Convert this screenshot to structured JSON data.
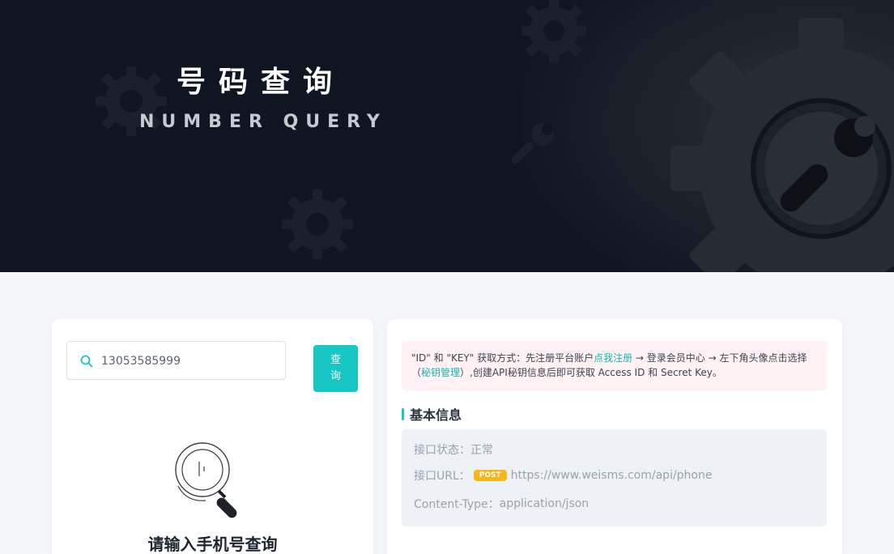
{
  "hero": {
    "title": "号码查询",
    "subtitle": "NUMBER QUERY"
  },
  "search": {
    "value": "13053585999",
    "button_label": "查询",
    "empty_text": "请输入手机号查询"
  },
  "notice": {
    "part1": "\"ID\" 和 \"KEY\" 获取方式：先注册平台账户",
    "register_link": "点我注册",
    "part2": " → 登录会员中心 → 左下角头像点击选择（",
    "secret_link": "秘钥管理",
    "part3": "）,创建API秘钥信息后即可获取 Access ID 和 Secret Key。"
  },
  "basic_info": {
    "title": "基本信息",
    "status_label": "接口状态：",
    "status_value": "正常",
    "url_label": "接口URL：",
    "method": "POST",
    "url_value": "https://www.weisms.com/api/phone",
    "content_type_label": "Content-Type：",
    "content_type_value": "application/json"
  },
  "colors": {
    "accent": "#16c7c4",
    "hero_bg": "#0f1621",
    "badge": "#f7b71a"
  },
  "icons": [
    "search-icon",
    "magnifier-illustration",
    "gear-icon",
    "wrench-icon"
  ]
}
